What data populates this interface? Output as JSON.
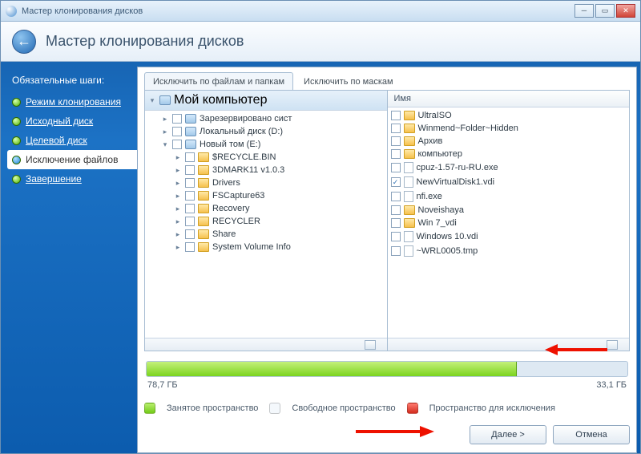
{
  "window": {
    "title": "Мастер клонирования дисков"
  },
  "header": {
    "title": "Мастер клонирования дисков"
  },
  "sidebar": {
    "caption": "Обязательные шаги:",
    "items": [
      {
        "label": "Режим клонирования",
        "active": false
      },
      {
        "label": "Исходный диск",
        "active": false
      },
      {
        "label": "Целевой диск",
        "active": false
      },
      {
        "label": "Исключение файлов",
        "active": true
      },
      {
        "label": "Завершение",
        "active": false
      }
    ]
  },
  "tabs": {
    "active": "Исключить по файлам и папкам",
    "inactive": "Исключить по маскам"
  },
  "tree": {
    "root": "Мой компьютер",
    "items": [
      {
        "indent": 1,
        "icon": "drive",
        "label": "Зарезервировано сист"
      },
      {
        "indent": 1,
        "icon": "drive",
        "label": "Локальный диск (D:)"
      },
      {
        "indent": 1,
        "icon": "drive",
        "label": "Новый том (E:)",
        "expanded": true
      },
      {
        "indent": 2,
        "icon": "folder",
        "label": "$RECYCLE.BIN"
      },
      {
        "indent": 2,
        "icon": "folder",
        "label": "3DMARK11 v1.0.3"
      },
      {
        "indent": 2,
        "icon": "folder",
        "label": "Drivers"
      },
      {
        "indent": 2,
        "icon": "folder",
        "label": "FSCapture63"
      },
      {
        "indent": 2,
        "icon": "folder",
        "label": "Recovery"
      },
      {
        "indent": 2,
        "icon": "folder",
        "label": "RECYCLER"
      },
      {
        "indent": 2,
        "icon": "folder",
        "label": "Share"
      },
      {
        "indent": 2,
        "icon": "folder",
        "label": "System Volume Info"
      }
    ]
  },
  "list": {
    "header": "Имя",
    "items": [
      {
        "icon": "folder",
        "label": "UltraISO",
        "checked": false
      },
      {
        "icon": "folder",
        "label": "Winmend~Folder~Hidden",
        "checked": false
      },
      {
        "icon": "folder",
        "label": "Архив",
        "checked": false
      },
      {
        "icon": "folder",
        "label": "компьютер",
        "checked": false
      },
      {
        "icon": "file",
        "label": "cpuz-1.57-ru-RU.exe",
        "checked": false
      },
      {
        "icon": "file",
        "label": "NewVirtualDisk1.vdi",
        "checked": true
      },
      {
        "icon": "file",
        "label": "nfi.exe",
        "checked": false
      },
      {
        "icon": "folder",
        "label": "Noveishaya",
        "checked": false
      },
      {
        "icon": "folder",
        "label": "Win 7_vdi",
        "checked": false
      },
      {
        "icon": "file",
        "label": "Windows 10.vdi",
        "checked": false
      },
      {
        "icon": "file",
        "label": "~WRL0005.tmp",
        "checked": false
      }
    ]
  },
  "capacity": {
    "used_label": "78,7 ГБ",
    "free_label": "33,1 ГБ",
    "used_pct": 77
  },
  "legend": {
    "used": "Занятое пространство",
    "free": "Свободное пространство",
    "excl": "Пространство для исключения"
  },
  "buttons": {
    "next": "Далее >",
    "cancel": "Отмена"
  }
}
